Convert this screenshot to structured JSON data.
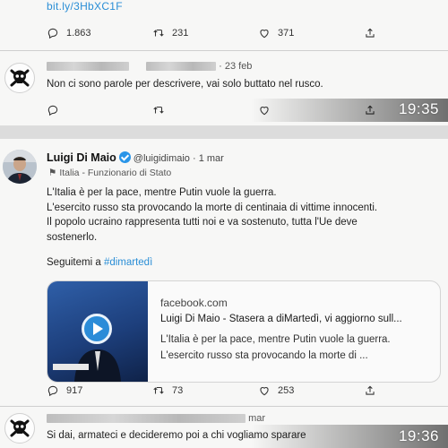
{
  "panel1": {
    "link": "bit.ly/3HbXC1F",
    "stats": {
      "replies": "1.863",
      "retweets": "231",
      "likes": "371"
    },
    "reply": {
      "date": "· 23 feb",
      "text": "Non ci sono parole per descrivere, vai solo buttato nel rusco."
    },
    "time": "19:35"
  },
  "panel2": {
    "tweet": {
      "name": "Luigi Di Maio",
      "handle": "@luigidimaio",
      "date": "· 1 mar",
      "label": "Italia - Funzionario di Stato",
      "body": [
        "L'Italia è per la pace, mentre Putin vuole la guerra.",
        "L'esercito russo sta provocando la morte di centinaia di vittime innocenti.",
        "Il popolo ucraino rappresenta tutti noi e va sostenuto, tutta l'Ue deve",
        "sostenerlo."
      ],
      "follow_prefix": "Seguitemi a ",
      "hashtag": "#dimartedì"
    },
    "card": {
      "domain": "facebook.com",
      "title": "Luigi Di Maio - Stasera a diMartedì, vi aggiorno sull...",
      "desc1": "L'Italia è per la pace, mentre Putin vuole la guerra.",
      "desc2": "L'esercito russo sta provocando la morte di ..."
    },
    "stats": {
      "replies": "917",
      "retweets": "73",
      "likes": "253"
    },
    "reply": {
      "date": "mar",
      "text": "Si dai, armateci e decideremo poi a chi vogliamo sparare"
    },
    "time": "19:36"
  },
  "colors": {
    "link": "#2a8ed6",
    "verified": "#2a95e8",
    "background": "#f7f7f6"
  }
}
